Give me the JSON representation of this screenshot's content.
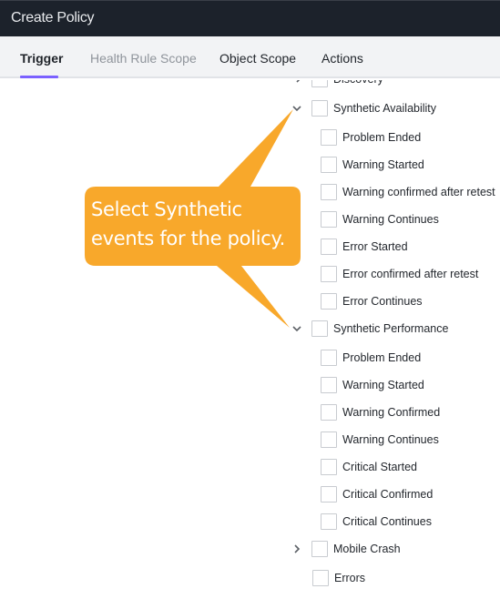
{
  "window": {
    "title": "Create Policy"
  },
  "tabs": [
    {
      "label": "Trigger",
      "state": "active"
    },
    {
      "label": "Health Rule Scope",
      "state": "disabled"
    },
    {
      "label": "Object Scope",
      "state": "normal"
    },
    {
      "label": "Actions",
      "state": "normal"
    }
  ],
  "tree": {
    "discovery": {
      "label": "Discovery",
      "expanded": false,
      "checked": false
    },
    "synthetic_availability": {
      "label": "Synthetic Availability",
      "expanded": true,
      "checked": false,
      "children": [
        {
          "label": "Problem Ended",
          "checked": false
        },
        {
          "label": "Warning Started",
          "checked": false
        },
        {
          "label": "Warning confirmed after retest",
          "checked": false
        },
        {
          "label": "Warning Continues",
          "checked": false
        },
        {
          "label": "Error Started",
          "checked": false
        },
        {
          "label": "Error confirmed after retest",
          "checked": false
        },
        {
          "label": "Error Continues",
          "checked": false
        }
      ]
    },
    "synthetic_performance": {
      "label": "Synthetic Performance",
      "expanded": true,
      "checked": false,
      "children": [
        {
          "label": "Problem Ended",
          "checked": false
        },
        {
          "label": "Warning Started",
          "checked": false
        },
        {
          "label": "Warning Confirmed",
          "checked": false
        },
        {
          "label": "Warning Continues",
          "checked": false
        },
        {
          "label": "Critical Started",
          "checked": false
        },
        {
          "label": "Critical Confirmed",
          "checked": false
        },
        {
          "label": "Critical Continues",
          "checked": false
        }
      ]
    },
    "mobile_crash": {
      "label": "Mobile Crash",
      "expanded": false,
      "checked": false
    },
    "errors": {
      "label": "Errors",
      "checked": false
    }
  },
  "callout": {
    "line1": "Select Synthetic",
    "line2": "events for the policy.",
    "color": "#f8a82b"
  },
  "colors": {
    "titlebar": "#1c222b",
    "tab_accent": "#7b61ff",
    "tabbar": "#f2f3f5"
  }
}
